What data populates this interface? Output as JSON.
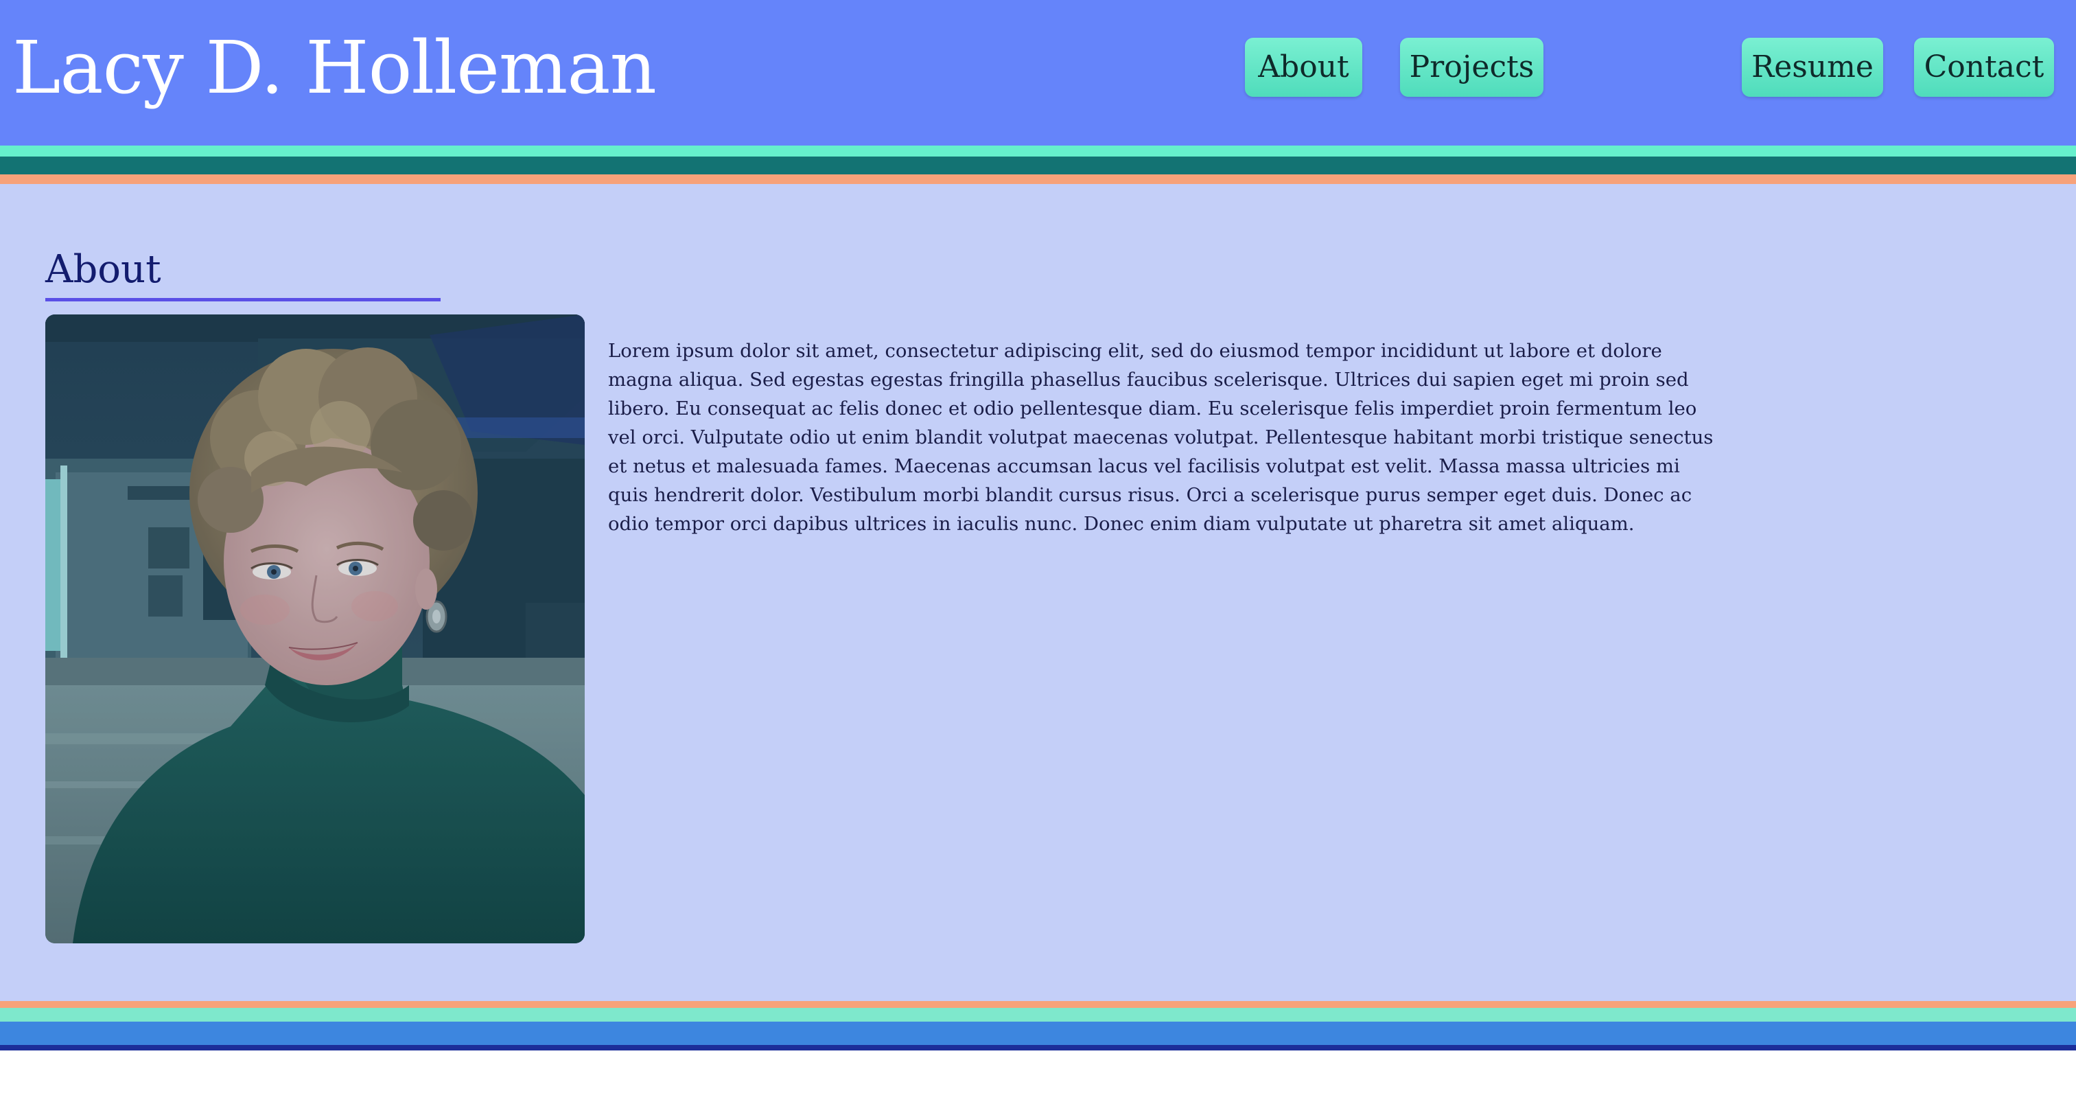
{
  "site": {
    "title": "Lacy D. Holleman"
  },
  "nav": {
    "items": [
      {
        "label": "About"
      },
      {
        "label": "Projects"
      },
      {
        "label": "Resume"
      },
      {
        "label": "Contact"
      }
    ]
  },
  "about": {
    "heading": "About",
    "bio": "Lorem ipsum dolor sit amet, consectetur adipiscing elit, sed do eiusmod tempor incididunt ut labore et dolore magna aliqua. Sed egestas egestas fringilla phasellus faucibus scelerisque. Ultrices dui sapien eget mi proin sed libero. Eu consequat ac felis donec et odio pellentesque diam. Eu scelerisque felis imperdiet proin fermentum leo vel orci. Vulputate odio ut enim blandit volutpat maecenas volutpat. Pellentesque habitant morbi tristique senectus et netus et malesuada fames. Maecenas accumsan lacus vel facilisis volutpat est velit. Massa massa ultricies mi quis hendrerit dolor. Vestibulum morbi blandit cursus risus. Orci a scelerisque purus semper eget duis. Donec ac odio tempor orci dapibus ultrices in iaculis nunc. Donec enim diam vulputate ut pharetra sit amet aliquam."
  },
  "colors": {
    "header_bg": "#6584fa",
    "content_bg": "#c4cff8",
    "button_bg": "#6aeac9",
    "heading_text": "#131c6e",
    "underline": "#5a4fe6",
    "stripe_mint": "#66f0cc",
    "stripe_teal": "#137373",
    "stripe_peach": "#f7a27a",
    "stripe_blue": "#3d86df",
    "stripe_navy": "#1c2e9a"
  }
}
